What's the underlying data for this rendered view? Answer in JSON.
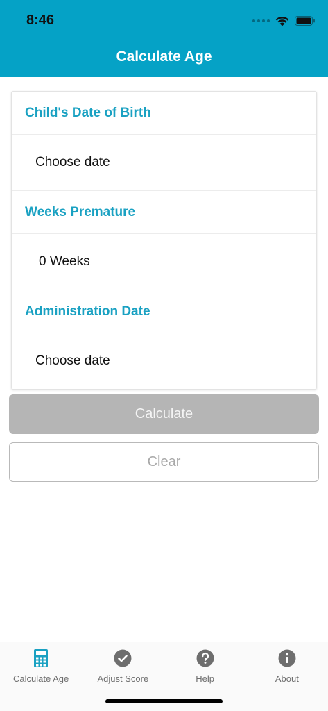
{
  "status": {
    "time": "8:46"
  },
  "header": {
    "title": "Calculate Age"
  },
  "form": {
    "dob_label": "Child's Date of Birth",
    "dob_value": "Choose date",
    "weeks_label": "Weeks Premature",
    "weeks_value": "0 Weeks",
    "admin_label": "Administration Date",
    "admin_value": "Choose date"
  },
  "buttons": {
    "calculate": "Calculate",
    "clear": "Clear"
  },
  "tabs": [
    {
      "label": "Calculate Age",
      "icon": "calculator-icon",
      "active": true
    },
    {
      "label": "Adjust Score",
      "icon": "checkmark-circle-icon",
      "active": false
    },
    {
      "label": "Help",
      "icon": "question-circle-icon",
      "active": false
    },
    {
      "label": "About",
      "icon": "info-circle-icon",
      "active": false
    }
  ],
  "colors": {
    "accent": "#05a2c6",
    "label": "#1aa1c2",
    "disabled": "#b5b5b5",
    "tab_icon": "#6e6e6e"
  }
}
